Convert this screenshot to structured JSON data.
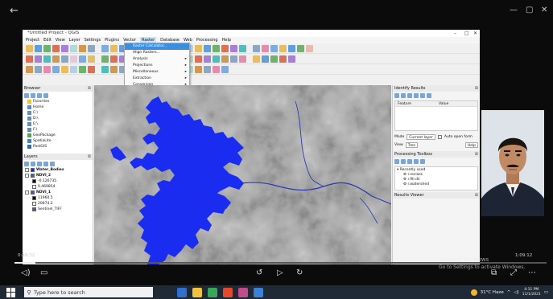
{
  "qgis": {
    "title": "*Untitled Project - QGIS",
    "menu": [
      "Project",
      "Edit",
      "View",
      "Layer",
      "Settings",
      "Plugins",
      "Vector",
      "Raster",
      "Database",
      "Web",
      "Processing",
      "Help"
    ],
    "active_menu": "Raster",
    "raster_menu": [
      {
        "label": "Raster Calculator...",
        "highlighted": true,
        "submenu": false
      },
      {
        "label": "Align Rasters...",
        "highlighted": false,
        "submenu": false
      },
      {
        "label": "Analysis",
        "highlighted": false,
        "submenu": true
      },
      {
        "label": "Projections",
        "highlighted": false,
        "submenu": true
      },
      {
        "label": "Miscellaneous",
        "highlighted": false,
        "submenu": true
      },
      {
        "label": "Extraction",
        "highlighted": false,
        "submenu": true
      },
      {
        "label": "Conversion",
        "highlighted": false,
        "submenu": true
      }
    ],
    "browser": {
      "title": "Browser",
      "items": [
        "Favorites",
        "Home",
        "C:\\",
        "D:\\",
        "E:\\",
        "F:\\",
        "GeoPackage",
        "SpatiaLite",
        "PostGIS"
      ]
    },
    "layers": {
      "title": "Layers",
      "items": [
        {
          "name": "Water_Bodies",
          "bold": true,
          "color": "#1030e0"
        },
        {
          "name": "NDVI_2",
          "bold": true,
          "color": "#2a60d0"
        },
        {
          "name": "-0.126735",
          "bold": false,
          "color": "#000000"
        },
        {
          "name": "0.469854",
          "bold": false,
          "color": "#ffffff"
        },
        {
          "name": "NDVI_1",
          "bold": true,
          "color": "#2a60d0"
        },
        {
          "name": "11960.5",
          "bold": false,
          "color": "#000000"
        },
        {
          "name": "20874.2",
          "bold": false,
          "color": "#ffffff"
        },
        {
          "name": "Sentinel_TIFF",
          "bold": false,
          "color": "#2a60d0"
        }
      ]
    },
    "identify": {
      "title": "Identify Results",
      "col_feature": "Feature",
      "col_value": "Value",
      "mode_label": "Mode",
      "mode_value": "Current layer",
      "auto_open": "Auto open form",
      "view_label": "View",
      "view_value": "Tree",
      "help": "Help"
    },
    "toolbox": {
      "title": "Processing Toolbox",
      "items": [
        "Recently used",
        "r.reclass",
        "r.fill.dir",
        "r.watershed"
      ]
    },
    "result_viewer": "Results Viewer"
  },
  "player": {
    "elapsed": "0:48:32",
    "remaining": "1:09:12",
    "progress": 0.04
  },
  "watermark": {
    "title": "Activate Windows",
    "subtitle": "Go to Settings to activate Windows."
  },
  "taskbar": {
    "search_placeholder": "Type here to search",
    "weather": "31°C  Haze",
    "time": "4:11 PM",
    "date": "11/1/2021"
  },
  "colors": {
    "water": "#1a2cf0",
    "taskbar": "#202a36",
    "highlight": "#3b8fde"
  }
}
